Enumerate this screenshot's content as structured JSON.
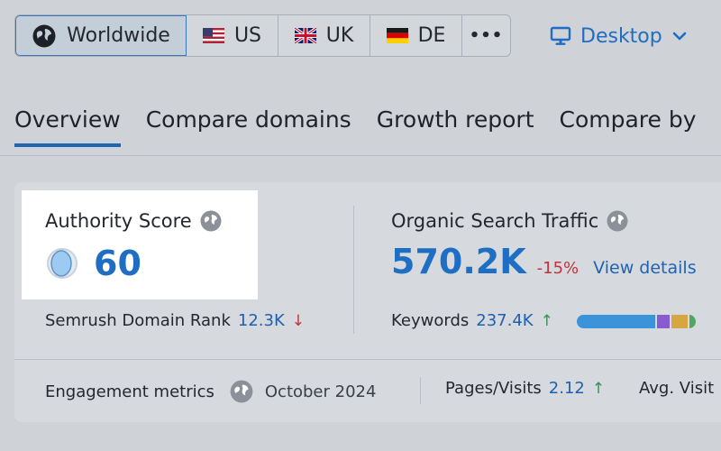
{
  "regions": [
    {
      "label": "Worldwide",
      "icon": "globe-icon",
      "active": true
    },
    {
      "label": "US",
      "icon": "flag-us-icon",
      "active": false
    },
    {
      "label": "UK",
      "icon": "flag-uk-icon",
      "active": false
    },
    {
      "label": "DE",
      "icon": "flag-de-icon",
      "active": false
    }
  ],
  "more_label": "•••",
  "device": {
    "label": "Desktop",
    "icon": "monitor-icon"
  },
  "tabs": [
    {
      "label": "Overview",
      "active": true
    },
    {
      "label": "Compare domains",
      "active": false
    },
    {
      "label": "Growth report",
      "active": false
    },
    {
      "label": "Compare by",
      "active": false
    }
  ],
  "authority": {
    "label": "Authority Score",
    "value": "60",
    "rank_label": "Semrush Domain Rank",
    "rank_value": "12.3K",
    "rank_arrow": "↓"
  },
  "traffic": {
    "label": "Organic Search Traffic",
    "value": "570.2K",
    "delta": "-15%",
    "link": "View details",
    "keywords_label": "Keywords",
    "keywords_value": "237.4K",
    "keywords_arrow": "↑",
    "bar_colors": [
      "#3b93d9",
      "#8a5ad0",
      "#d6a640",
      "#4ea85f"
    ],
    "bar_shares": [
      0.66,
      0.12,
      0.15,
      0.07
    ]
  },
  "engagement": {
    "label": "Engagement metrics",
    "date": "October 2024",
    "pages_label": "Pages/Visits",
    "pages_value": "2.12",
    "pages_arrow": "↑",
    "avg_label": "Avg. Visit"
  },
  "colors": {
    "accent": "#1e6fc4",
    "negative": "#c0333a",
    "positive": "#3c8f57"
  }
}
